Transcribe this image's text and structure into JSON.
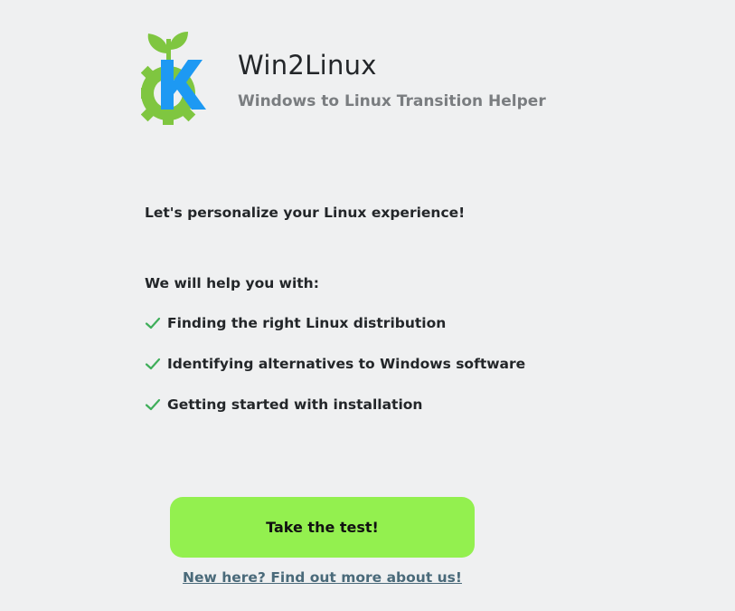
{
  "header": {
    "logo_icon": "kde-gear-leaf-logo-icon",
    "title": "Win2Linux",
    "subtitle": "Windows to Linux Transition Helper"
  },
  "main": {
    "intro": "Let's personalize your Linux experience!",
    "help_heading": "We will help you with:",
    "features": [
      {
        "icon": "check-icon",
        "label": "Finding the right Linux distribution"
      },
      {
        "icon": "check-icon",
        "label": "Identifying alternatives to Windows software"
      },
      {
        "icon": "check-icon",
        "label": "Getting started with installation"
      }
    ]
  },
  "actions": {
    "primary_label": "Take the test!",
    "about_link": "New here? Find out more about us!"
  },
  "colors": {
    "background": "#eff0f1",
    "accent_button": "#93f04f",
    "logo_green": "#7fc640",
    "logo_blue": "#1d99f3",
    "check_green": "#3fae5a",
    "link": "#4a6a7a"
  }
}
